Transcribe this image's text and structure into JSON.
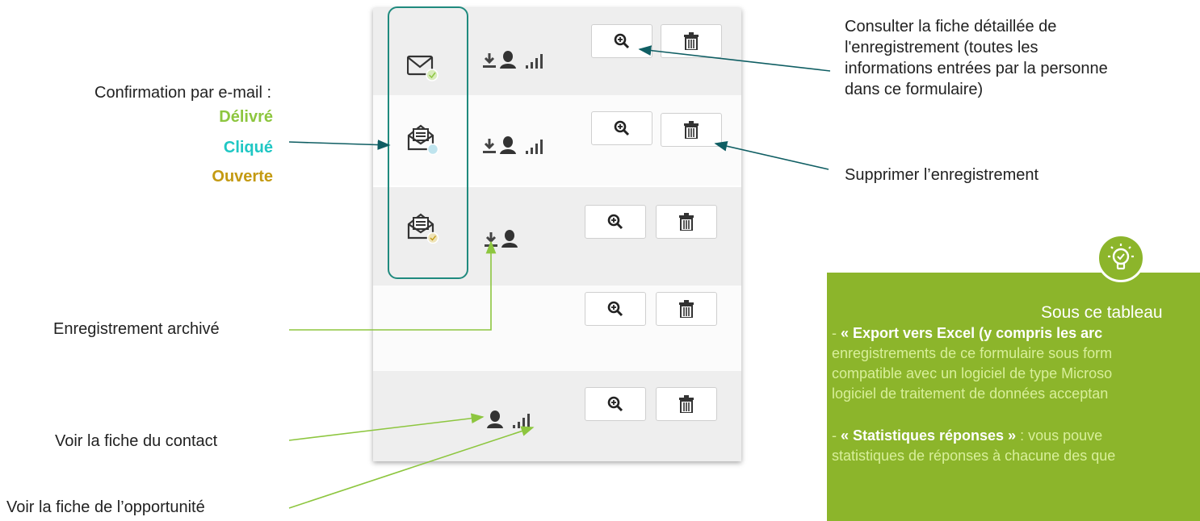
{
  "annotations": {
    "email_title": "Confirmation par e-mail :",
    "status_delivered": "Délivré",
    "status_clicked": "Cliqué",
    "status_opened": "Ouverte",
    "archived": "Enregistrement archivé",
    "contact": "Voir la fiche du contact",
    "opportunity": "Voir la fiche de l’opportunité",
    "details_line1": "Consulter la fiche détaillée de",
    "details_line2": "l'enregistrement (toutes les",
    "details_line3": "informations entrées par la personne",
    "details_line4": "dans ce formulaire)",
    "delete": "Supprimer l’enregistrement"
  },
  "colors": {
    "delivered": "#8dc63f",
    "clicked": "#1fc7c4",
    "opened": "#c49a12",
    "outline": "#1f8a7e",
    "arrow_dark": "#0f5e63",
    "arrow_green": "#8dc63f",
    "tip_bg": "#8cb52b"
  },
  "rows": [
    {
      "email_icon": "envelope-delivered-icon",
      "icons": [
        "download-icon",
        "contact-icon",
        "stats-icon"
      ],
      "buttons": [
        "zoom-icon",
        "trash-icon"
      ]
    },
    {
      "email_icon": "envelope-clicked-icon",
      "icons": [
        "download-icon",
        "contact-icon",
        "stats-icon"
      ],
      "buttons": [
        "zoom-icon",
        "trash-icon"
      ]
    },
    {
      "email_icon": "envelope-opened-icon",
      "icons": [
        "download-icon",
        "contact-icon"
      ],
      "buttons": [
        "zoom-icon",
        "trash-icon"
      ]
    },
    {
      "icons": [],
      "buttons": [
        "zoom-icon",
        "trash-icon"
      ]
    },
    {
      "icons": [
        "contact-icon",
        "stats-icon"
      ],
      "buttons": [
        "zoom-icon",
        "trash-icon"
      ]
    }
  ],
  "tip": {
    "icon": "lightbulb-icon",
    "title": "Sous ce tableau",
    "export_label": "« Export vers Excel (y compris les arc",
    "export_prefix": "- ",
    "export_line2": "enregistrements de ce formulaire sous form",
    "export_line3": "compatible avec un logiciel de type Microso",
    "export_line4": "logiciel de traitement de données acceptan",
    "stats_prefix": "- ",
    "stats_label": "« Statistiques réponses »",
    "stats_rest": " : vous pouve",
    "stats_line2": "statistiques de réponses à chacune des que"
  }
}
